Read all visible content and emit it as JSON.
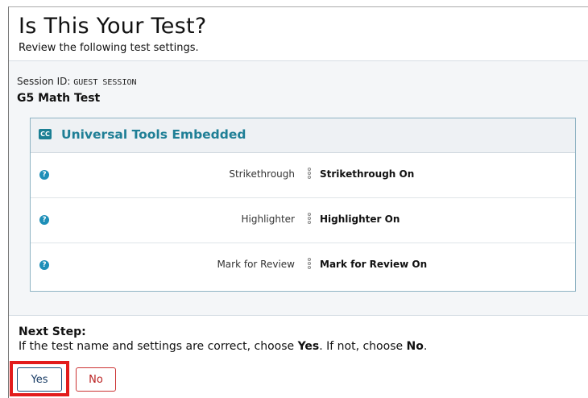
{
  "header": {
    "title": "Is This Your Test?",
    "subtitle": "Review the following test settings."
  },
  "session": {
    "label": "Session ID:",
    "value": "GUEST SESSION"
  },
  "test_name": "G5 Math Test",
  "panel": {
    "icon": "closed-caption-icon",
    "icon_text": "CC",
    "title": "Universal Tools Embedded",
    "rows": [
      {
        "label": "Strikethrough",
        "value": "Strikethrough On",
        "help_icon": "?"
      },
      {
        "label": "Highlighter",
        "value": "Highlighter On",
        "help_icon": "?"
      },
      {
        "label": "Mark for Review",
        "value": "Mark for Review On",
        "help_icon": "?"
      }
    ]
  },
  "next_step": {
    "heading": "Next Step:",
    "text_before_yes": "If the test name and settings are correct, choose ",
    "yes_word": "Yes",
    "text_middle": ". If not, choose ",
    "no_word": "No",
    "text_end": "."
  },
  "buttons": {
    "yes": "Yes",
    "no": "No"
  },
  "colors": {
    "accent": "#1f7f96",
    "highlight_box": "#e21c1c",
    "help_icon": "#1e8fb8",
    "no_button": "#b22222",
    "yes_button": "#1a3d66"
  }
}
